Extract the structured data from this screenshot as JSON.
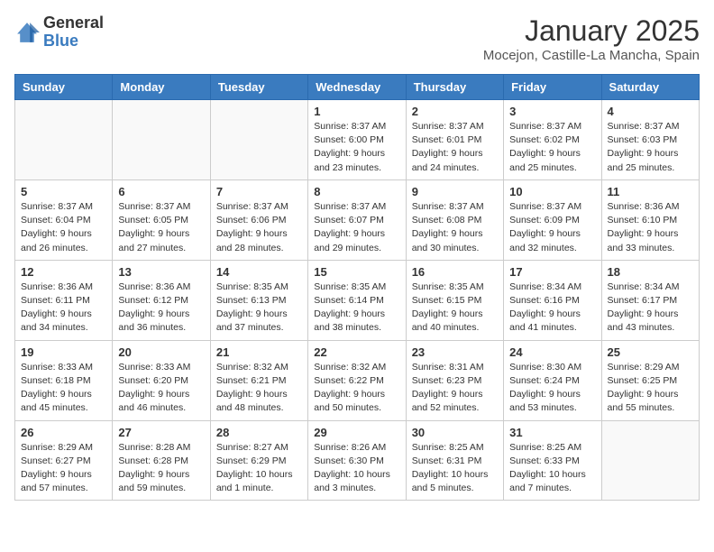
{
  "logo": {
    "general": "General",
    "blue": "Blue"
  },
  "title": "January 2025",
  "location": "Mocejon, Castille-La Mancha, Spain",
  "weekdays": [
    "Sunday",
    "Monday",
    "Tuesday",
    "Wednesday",
    "Thursday",
    "Friday",
    "Saturday"
  ],
  "weeks": [
    [
      {
        "day": "",
        "info": ""
      },
      {
        "day": "",
        "info": ""
      },
      {
        "day": "",
        "info": ""
      },
      {
        "day": "1",
        "info": "Sunrise: 8:37 AM\nSunset: 6:00 PM\nDaylight: 9 hours\nand 23 minutes."
      },
      {
        "day": "2",
        "info": "Sunrise: 8:37 AM\nSunset: 6:01 PM\nDaylight: 9 hours\nand 24 minutes."
      },
      {
        "day": "3",
        "info": "Sunrise: 8:37 AM\nSunset: 6:02 PM\nDaylight: 9 hours\nand 25 minutes."
      },
      {
        "day": "4",
        "info": "Sunrise: 8:37 AM\nSunset: 6:03 PM\nDaylight: 9 hours\nand 25 minutes."
      }
    ],
    [
      {
        "day": "5",
        "info": "Sunrise: 8:37 AM\nSunset: 6:04 PM\nDaylight: 9 hours\nand 26 minutes."
      },
      {
        "day": "6",
        "info": "Sunrise: 8:37 AM\nSunset: 6:05 PM\nDaylight: 9 hours\nand 27 minutes."
      },
      {
        "day": "7",
        "info": "Sunrise: 8:37 AM\nSunset: 6:06 PM\nDaylight: 9 hours\nand 28 minutes."
      },
      {
        "day": "8",
        "info": "Sunrise: 8:37 AM\nSunset: 6:07 PM\nDaylight: 9 hours\nand 29 minutes."
      },
      {
        "day": "9",
        "info": "Sunrise: 8:37 AM\nSunset: 6:08 PM\nDaylight: 9 hours\nand 30 minutes."
      },
      {
        "day": "10",
        "info": "Sunrise: 8:37 AM\nSunset: 6:09 PM\nDaylight: 9 hours\nand 32 minutes."
      },
      {
        "day": "11",
        "info": "Sunrise: 8:36 AM\nSunset: 6:10 PM\nDaylight: 9 hours\nand 33 minutes."
      }
    ],
    [
      {
        "day": "12",
        "info": "Sunrise: 8:36 AM\nSunset: 6:11 PM\nDaylight: 9 hours\nand 34 minutes."
      },
      {
        "day": "13",
        "info": "Sunrise: 8:36 AM\nSunset: 6:12 PM\nDaylight: 9 hours\nand 36 minutes."
      },
      {
        "day": "14",
        "info": "Sunrise: 8:35 AM\nSunset: 6:13 PM\nDaylight: 9 hours\nand 37 minutes."
      },
      {
        "day": "15",
        "info": "Sunrise: 8:35 AM\nSunset: 6:14 PM\nDaylight: 9 hours\nand 38 minutes."
      },
      {
        "day": "16",
        "info": "Sunrise: 8:35 AM\nSunset: 6:15 PM\nDaylight: 9 hours\nand 40 minutes."
      },
      {
        "day": "17",
        "info": "Sunrise: 8:34 AM\nSunset: 6:16 PM\nDaylight: 9 hours\nand 41 minutes."
      },
      {
        "day": "18",
        "info": "Sunrise: 8:34 AM\nSunset: 6:17 PM\nDaylight: 9 hours\nand 43 minutes."
      }
    ],
    [
      {
        "day": "19",
        "info": "Sunrise: 8:33 AM\nSunset: 6:18 PM\nDaylight: 9 hours\nand 45 minutes."
      },
      {
        "day": "20",
        "info": "Sunrise: 8:33 AM\nSunset: 6:20 PM\nDaylight: 9 hours\nand 46 minutes."
      },
      {
        "day": "21",
        "info": "Sunrise: 8:32 AM\nSunset: 6:21 PM\nDaylight: 9 hours\nand 48 minutes."
      },
      {
        "day": "22",
        "info": "Sunrise: 8:32 AM\nSunset: 6:22 PM\nDaylight: 9 hours\nand 50 minutes."
      },
      {
        "day": "23",
        "info": "Sunrise: 8:31 AM\nSunset: 6:23 PM\nDaylight: 9 hours\nand 52 minutes."
      },
      {
        "day": "24",
        "info": "Sunrise: 8:30 AM\nSunset: 6:24 PM\nDaylight: 9 hours\nand 53 minutes."
      },
      {
        "day": "25",
        "info": "Sunrise: 8:29 AM\nSunset: 6:25 PM\nDaylight: 9 hours\nand 55 minutes."
      }
    ],
    [
      {
        "day": "26",
        "info": "Sunrise: 8:29 AM\nSunset: 6:27 PM\nDaylight: 9 hours\nand 57 minutes."
      },
      {
        "day": "27",
        "info": "Sunrise: 8:28 AM\nSunset: 6:28 PM\nDaylight: 9 hours\nand 59 minutes."
      },
      {
        "day": "28",
        "info": "Sunrise: 8:27 AM\nSunset: 6:29 PM\nDaylight: 10 hours\nand 1 minute."
      },
      {
        "day": "29",
        "info": "Sunrise: 8:26 AM\nSunset: 6:30 PM\nDaylight: 10 hours\nand 3 minutes."
      },
      {
        "day": "30",
        "info": "Sunrise: 8:25 AM\nSunset: 6:31 PM\nDaylight: 10 hours\nand 5 minutes."
      },
      {
        "day": "31",
        "info": "Sunrise: 8:25 AM\nSunset: 6:33 PM\nDaylight: 10 hours\nand 7 minutes."
      },
      {
        "day": "",
        "info": ""
      }
    ]
  ]
}
